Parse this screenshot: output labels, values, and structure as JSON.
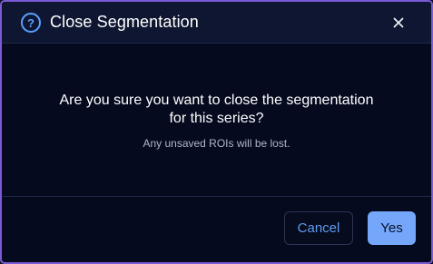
{
  "dialog": {
    "title": "Close Segmentation",
    "help_icon": "question-circle-icon",
    "close_icon": "close-icon",
    "question_line1": "Are you sure you want to close the segmentation",
    "question_line2": "for this series?",
    "note": "Any unsaved ROIs will be lost.",
    "cancel_label": "Cancel",
    "confirm_label": "Yes"
  },
  "colors": {
    "accent": "#74a7fa",
    "border": "#7b5ad6",
    "background": "#050a1f",
    "header_background": "#0e1631"
  }
}
